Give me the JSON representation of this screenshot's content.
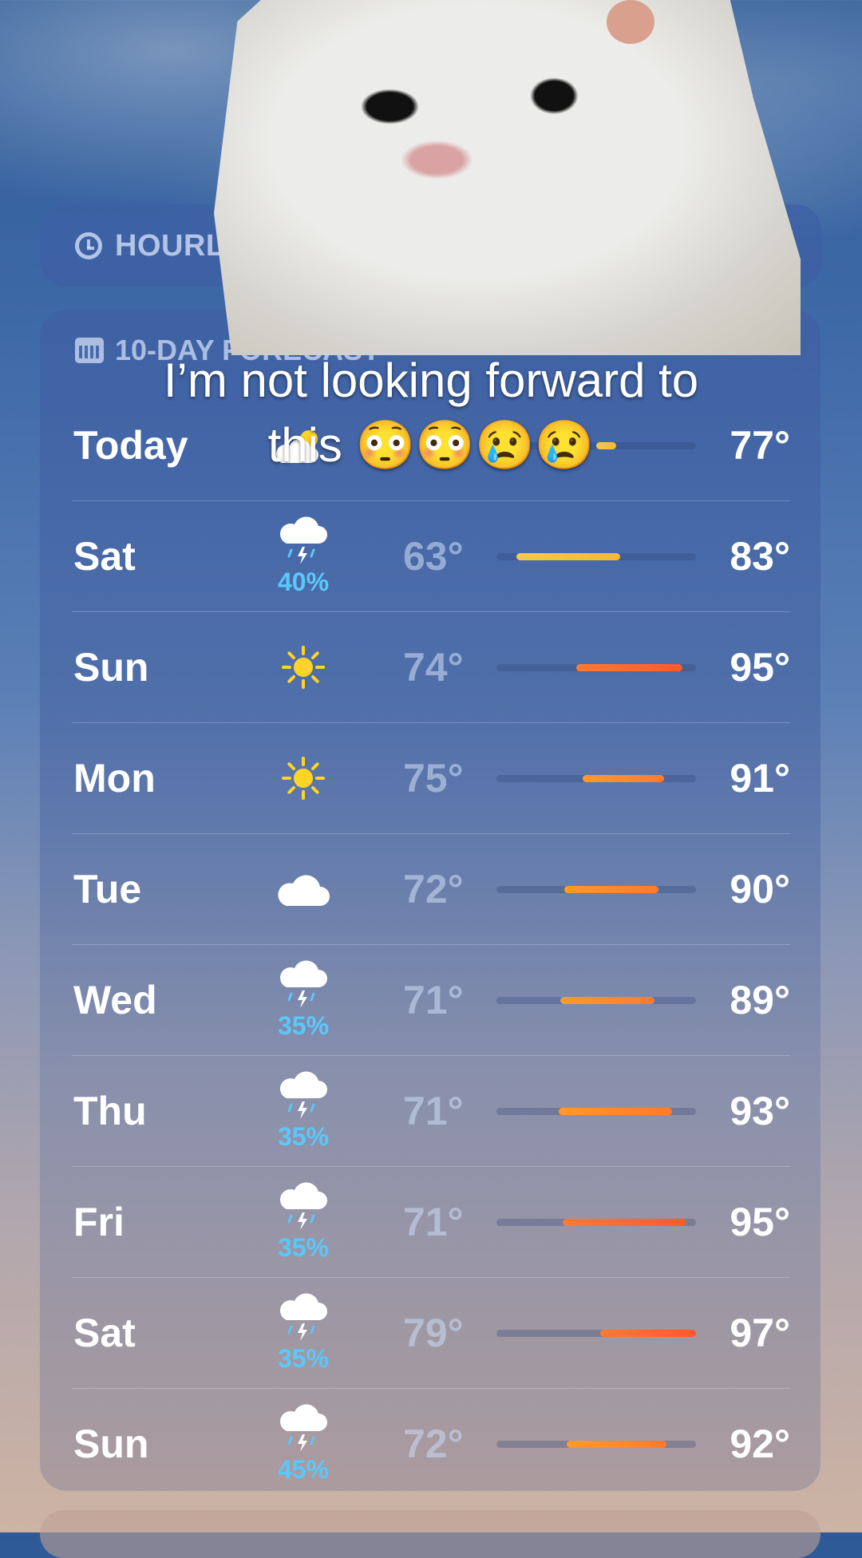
{
  "hourly": {
    "label": "HOURLY F"
  },
  "forecast": {
    "header": "10-DAY FORECAST",
    "days": [
      {
        "day": "Today",
        "icon": "partly-sunny-icon",
        "precip": "",
        "low": "",
        "high": "77°",
        "bar_from": 0.5,
        "bar_to": 0.6
      },
      {
        "day": "Sat",
        "icon": "thunderstorm-icon",
        "precip": "40%",
        "low": "63°",
        "high": "83°",
        "bar_from": 0.1,
        "bar_to": 0.62
      },
      {
        "day": "Sun",
        "icon": "sun-icon",
        "precip": "",
        "low": "74°",
        "high": "95°",
        "bar_from": 0.4,
        "bar_to": 0.93
      },
      {
        "day": "Mon",
        "icon": "sun-icon",
        "precip": "",
        "low": "75°",
        "high": "91°",
        "bar_from": 0.43,
        "bar_to": 0.84
      },
      {
        "day": "Tue",
        "icon": "cloud-icon",
        "precip": "",
        "low": "72°",
        "high": "90°",
        "bar_from": 0.34,
        "bar_to": 0.81
      },
      {
        "day": "Wed",
        "icon": "thunderstorm-icon",
        "precip": "35%",
        "low": "71°",
        "high": "89°",
        "bar_from": 0.32,
        "bar_to": 0.79
      },
      {
        "day": "Thu",
        "icon": "thunderstorm-icon",
        "precip": "35%",
        "low": "71°",
        "high": "93°",
        "bar_from": 0.31,
        "bar_to": 0.88
      },
      {
        "day": "Fri",
        "icon": "thunderstorm-icon",
        "precip": "35%",
        "low": "71°",
        "high": "95°",
        "bar_from": 0.33,
        "bar_to": 0.95
      },
      {
        "day": "Sat",
        "icon": "thunderstorm-icon",
        "precip": "35%",
        "low": "79°",
        "high": "97°",
        "bar_from": 0.52,
        "bar_to": 1.0
      },
      {
        "day": "Sun",
        "icon": "thunderstorm-icon",
        "precip": "45%",
        "low": "72°",
        "high": "92°",
        "bar_from": 0.35,
        "bar_to": 0.85
      }
    ]
  },
  "overlay": {
    "caption_line1": "I’m not looking forward to",
    "caption_line2": "this 😳😳😢😢"
  },
  "colors": {
    "precip": "#5ac8fa",
    "sun": "#ffd426",
    "bar_cool": "#f2c94c",
    "bar_warm": "#ff7a2f",
    "bar_hot": "#ff5a2a"
  }
}
